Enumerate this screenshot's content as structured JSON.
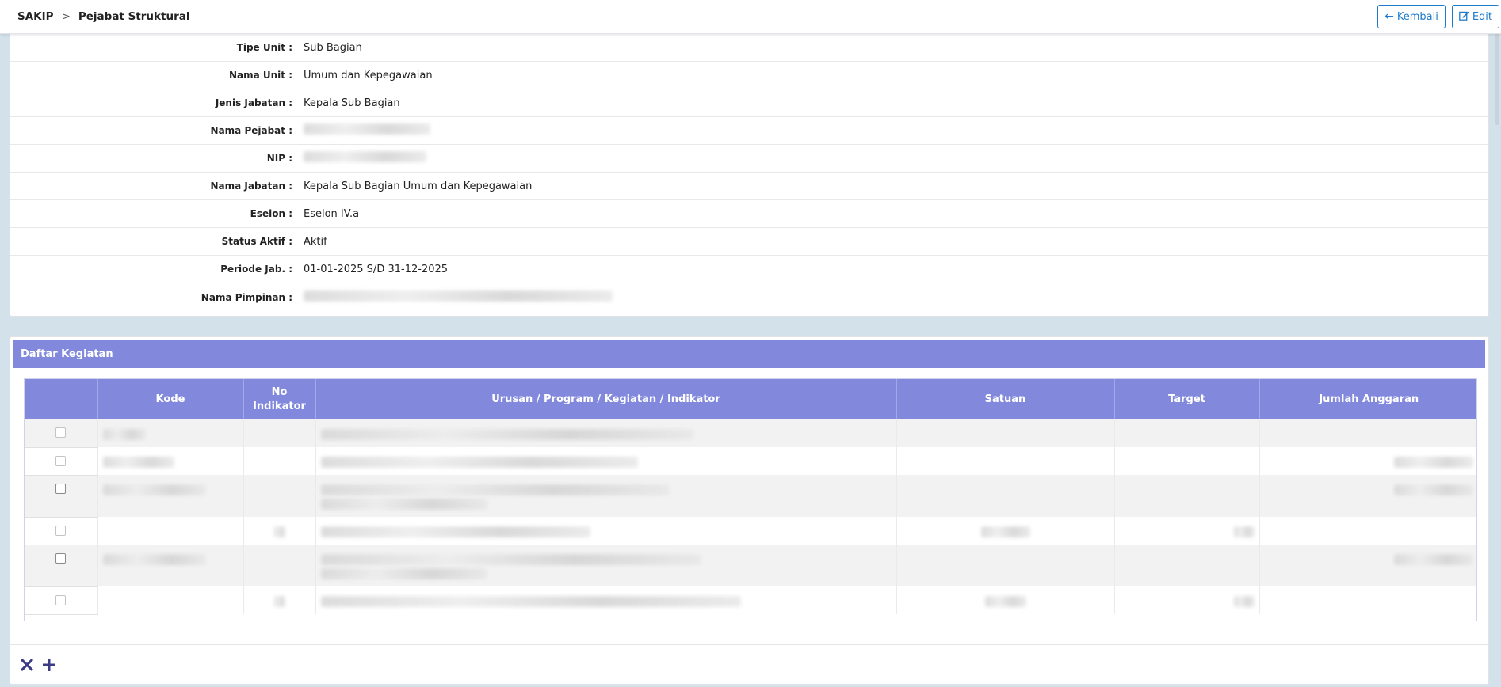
{
  "breadcrumb": {
    "root": "SAKIP",
    "separator": ">",
    "current": "Pejabat Struktural"
  },
  "actions": {
    "back_label": "Kembali",
    "edit_label": "Edit"
  },
  "details": [
    {
      "label": "Tipe Unit :",
      "value": "Sub Bagian"
    },
    {
      "label": "Nama Unit :",
      "value": "Umum dan Kepegawaian"
    },
    {
      "label": "Jenis Jabatan :",
      "value": "Kepala Sub Bagian"
    },
    {
      "label": "Nama Pejabat :",
      "value": ""
    },
    {
      "label": "NIP :",
      "value": ""
    },
    {
      "label": "Nama Jabatan :",
      "value": "Kepala Sub Bagian Umum dan Kepegawaian"
    },
    {
      "label": "Eselon :",
      "value": "Eselon IV.a"
    },
    {
      "label": "Status Aktif :",
      "value": "Aktif"
    },
    {
      "label": "Periode Jab. :",
      "value": "01-01-2025 S/D 31-12-2025"
    },
    {
      "label": "Nama Pimpinan :",
      "value": ""
    }
  ],
  "kegiatan": {
    "title": "Daftar Kegiatan",
    "columns": {
      "check": "",
      "kode": "Kode",
      "no_indikator_1": "No",
      "no_indikator_2": "Indikator",
      "urusan": "Urusan / Program / Kegiatan / Indikator",
      "satuan": "Satuan",
      "target": "Target",
      "jumlah": "Jumlah Anggaran"
    }
  },
  "colors": {
    "header": "#8289dc",
    "accent": "#1f7bc9",
    "toolbar_icon": "#3d3b85"
  },
  "icons": {
    "back": "arrow-left-icon",
    "edit": "edit-icon",
    "delete": "close-icon",
    "add": "plus-icon"
  }
}
